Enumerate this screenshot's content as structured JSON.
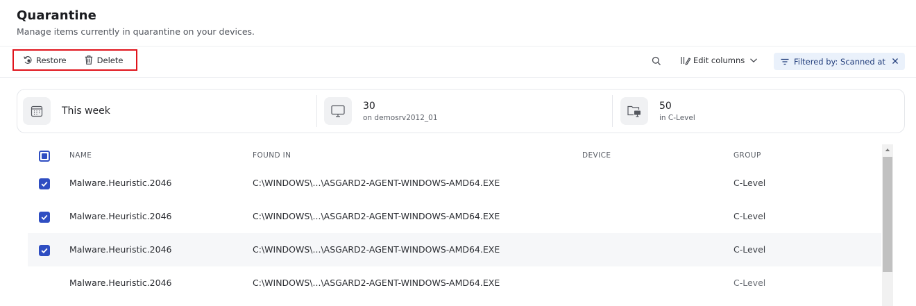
{
  "header": {
    "title": "Quarantine",
    "subtitle": "Manage items currently in quarantine on your devices."
  },
  "toolbar": {
    "restore_label": "Restore",
    "delete_label": "Delete",
    "edit_columns_label": "Edit columns",
    "filter_label": "Filtered by: Scanned at"
  },
  "summary": {
    "period_label": "This week",
    "device_count": "30",
    "device_sub": "on demosrv2012_01",
    "group_count": "50",
    "group_sub": "in C-Level"
  },
  "table": {
    "columns": [
      "NAME",
      "FOUND IN",
      "DEVICE",
      "GROUP"
    ],
    "rows": [
      {
        "name": "Malware.Heuristic.2046",
        "found_in": "C:\\WINDOWS\\...\\ASGARD2-AGENT-WINDOWS-AMD64.EXE",
        "device": "",
        "group": "C-Level",
        "checked": true
      },
      {
        "name": "Malware.Heuristic.2046",
        "found_in": "C:\\WINDOWS\\...\\ASGARD2-AGENT-WINDOWS-AMD64.EXE",
        "device": "",
        "group": "C-Level",
        "checked": true
      },
      {
        "name": "Malware.Heuristic.2046",
        "found_in": "C:\\WINDOWS\\...\\ASGARD2-AGENT-WINDOWS-AMD64.EXE",
        "device": "",
        "group": "C-Level",
        "checked": true
      },
      {
        "name": "Malware.Heuristic.2046",
        "found_in": "C:\\WINDOWS\\...\\ASGARD2-AGENT-WINDOWS-AMD64.EXE",
        "device": "",
        "group": "C-Level",
        "checked": false
      }
    ]
  },
  "colors": {
    "accent": "#2f4ec2",
    "highlight_box": "#e0131b",
    "filter_chip_bg": "#eaf1fb"
  },
  "icons": {
    "restore": "restore-icon",
    "delete": "trash-icon",
    "search": "search-icon",
    "edit_columns": "columns-icon",
    "filter": "filter-icon",
    "calendar": "calendar-icon",
    "monitor": "monitor-icon",
    "group": "folder-device-icon"
  }
}
